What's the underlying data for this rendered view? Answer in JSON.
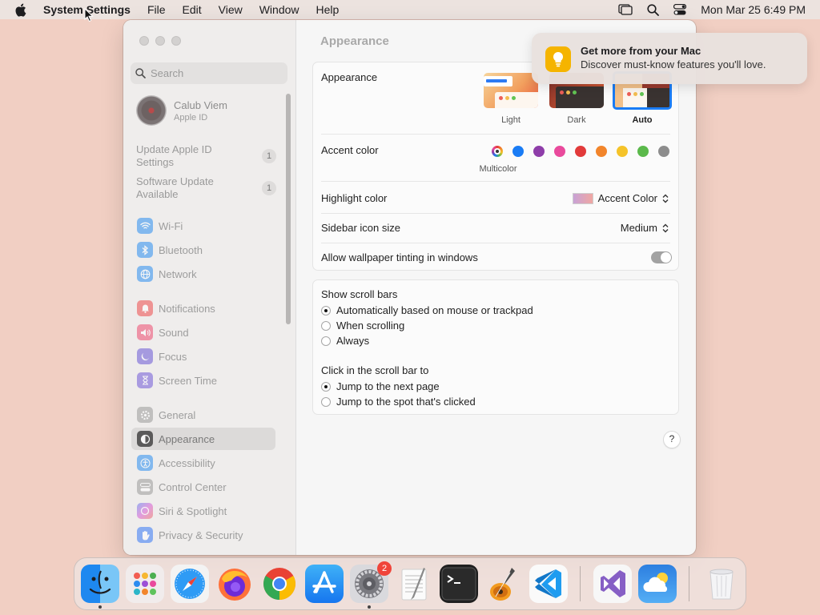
{
  "menubar": {
    "app_name": "System Settings",
    "menus": [
      "File",
      "Edit",
      "View",
      "Window",
      "Help"
    ],
    "clock": "Mon Mar 25  6:49 PM"
  },
  "sidebar": {
    "search_placeholder": "Search",
    "profile": {
      "name": "Calub Viem",
      "sub": "Apple ID"
    },
    "notices": [
      {
        "label": "Update Apple ID Settings",
        "count": "1"
      },
      {
        "label": "Software Update Available",
        "count": "1"
      }
    ],
    "items": [
      {
        "label": "Wi-Fi",
        "icon": "wifi-icon",
        "color": "#2a8ef0"
      },
      {
        "label": "Bluetooth",
        "icon": "bluetooth-icon",
        "color": "#2a8ef0"
      },
      {
        "label": "Network",
        "icon": "globe-icon",
        "color": "#2a8ef0"
      },
      {
        "label": "Notifications",
        "icon": "bell-icon",
        "color": "#ee4b4b"
      },
      {
        "label": "Sound",
        "icon": "speaker-icon",
        "color": "#ee4b6f"
      },
      {
        "label": "Focus",
        "icon": "moon-icon",
        "color": "#6a57d6"
      },
      {
        "label": "Screen Time",
        "icon": "hourglass-icon",
        "color": "#7159d7"
      },
      {
        "label": "General",
        "icon": "gear-icon",
        "color": "#9a9a9a"
      },
      {
        "label": "Appearance",
        "icon": "appearance-icon",
        "color": "#1f1f1f"
      },
      {
        "label": "Accessibility",
        "icon": "accessibility-icon",
        "color": "#2a8ef0"
      },
      {
        "label": "Control Center",
        "icon": "control-center-icon",
        "color": "#9a9a9a"
      },
      {
        "label": "Siri & Spotlight",
        "icon": "siri-icon",
        "color": "#d65ad5"
      },
      {
        "label": "Privacy & Security",
        "icon": "hand-icon",
        "color": "#3478f6"
      }
    ]
  },
  "content": {
    "title": "Appearance",
    "appearance": {
      "label": "Appearance",
      "options": [
        "Light",
        "Dark",
        "Auto"
      ],
      "selected": "Auto"
    },
    "accent": {
      "label": "Accent color",
      "caption": "Multicolor",
      "colors": [
        "multicolor",
        "#1a7cf5",
        "#8e3da9",
        "#e94a9c",
        "#e23a3a",
        "#f2852b",
        "#f5c329",
        "#5bb94b",
        "#8d8d8d"
      ]
    },
    "highlight": {
      "label": "Highlight color",
      "value": "Accent Color"
    },
    "sidebar_icon": {
      "label": "Sidebar icon size",
      "value": "Medium"
    },
    "wallpaper_tint": {
      "label": "Allow wallpaper tinting in windows",
      "on": false
    },
    "scrollbars": {
      "label": "Show scroll bars",
      "options": [
        "Automatically based on mouse or trackpad",
        "When scrolling",
        "Always"
      ],
      "selected": 0
    },
    "click_scroll": {
      "label": "Click in the scroll bar to",
      "options": [
        "Jump to the next page",
        "Jump to the spot that's clicked"
      ],
      "selected": 0
    },
    "help": "?"
  },
  "notification": {
    "title": "Get more from your Mac",
    "body": "Discover must-know features you'll love."
  },
  "dock": {
    "apps": [
      "Finder",
      "Launchpad",
      "Safari",
      "Firefox",
      "Chrome",
      "App Store",
      "System Settings",
      "TextEdit",
      "Terminal",
      "GarageBand",
      "Visual Studio Code",
      "Visual Studio",
      "Weather",
      "Trash"
    ],
    "settings_badge": "2"
  }
}
